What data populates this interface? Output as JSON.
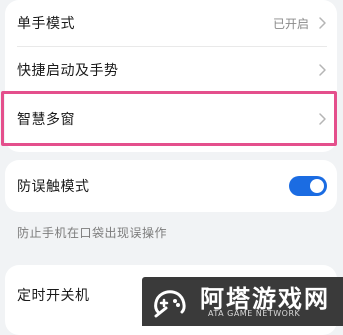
{
  "settings_group_1": {
    "items": [
      {
        "label": "单手模式",
        "value": "已开启",
        "icon": "chevron-right-icon"
      },
      {
        "label": "快捷启动及手势",
        "value": "",
        "icon": "chevron-right-icon"
      },
      {
        "label": "智慧多窗",
        "value": "",
        "icon": "chevron-right-icon"
      }
    ]
  },
  "mistouch": {
    "label": "防误触模式",
    "toggle_state": "on",
    "description": "防止手机在口袋出现误操作"
  },
  "scheduled_power": {
    "label": "定时开关机",
    "icon": "chevron-right-icon"
  },
  "highlight_color": "#e44f8c",
  "toggle_color": "#1b6ce2",
  "watermark": {
    "title": "阿塔游戏网",
    "subtitle": "ATA GAME NETWORK",
    "icon": "gamepad-logo-icon"
  }
}
